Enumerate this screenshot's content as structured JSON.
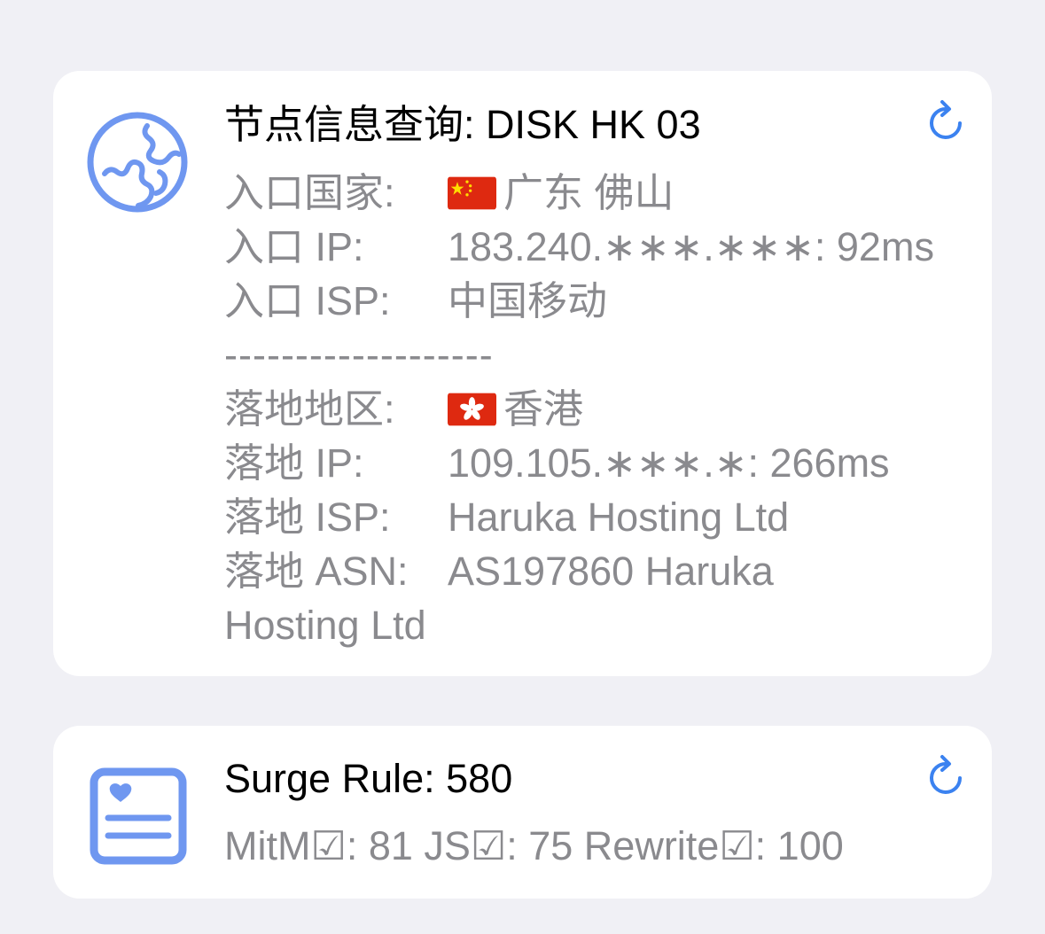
{
  "node_card": {
    "title": "节点信息查询: DISK HK 03",
    "icon": "globe-icon",
    "refresh_icon": "refresh-icon",
    "accent_color": "#5a8cf0",
    "entry": {
      "country_label": "入口国家:",
      "country_flag": "cn-flag-icon",
      "country_value": "广东 佛山",
      "ip_label": "入口 IP:",
      "ip_value": "183.240.∗∗∗.∗∗∗: 92ms",
      "isp_label": "入口 ISP:",
      "isp_value": "中国移动"
    },
    "divider": "-------------------",
    "landing": {
      "region_label": "落地地区:",
      "region_flag": "hk-flag-icon",
      "region_value": "香港",
      "ip_label": "落地 IP:",
      "ip_value": "109.105.∗∗∗.∗: 266ms",
      "isp_label": "落地 ISP:",
      "isp_value": "Haruka Hosting Ltd",
      "asn_label": "落地 ASN:",
      "asn_value_line1": "AS197860 Haruka",
      "asn_value_line2": "Hosting Ltd"
    }
  },
  "surge_card": {
    "title": "Surge Rule: 580",
    "icon": "rule-card-icon",
    "refresh_icon": "refresh-icon",
    "summary": "MitM☑: 81 JS☑: 75 Rewrite☑: 100"
  }
}
